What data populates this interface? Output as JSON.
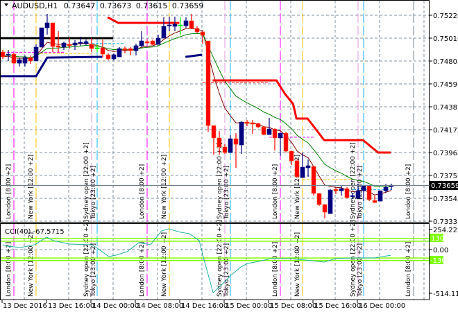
{
  "header": {
    "dropdown_icon": "triangle-down-icon",
    "symbol": "AUDUSD,H1",
    "open": "0.73647",
    "high": "0.73673",
    "low": "0.73615",
    "close": "0.73659"
  },
  "price_axis": {
    "labels": [
      "0.75220",
      "0.75010",
      "0.74805",
      "0.74595",
      "0.74385",
      "0.74175",
      "0.73965",
      "0.73755",
      "0.73545",
      "0.73335"
    ],
    "current_price": "0.73659"
  },
  "indicator": {
    "label": "CCI(40) -67.5715",
    "axis_max": "254.2226",
    "axis_zero": "0.00",
    "axis_min": "-514.1127",
    "level_high": "130",
    "level_low": "-130",
    "level_color": "#80ff00"
  },
  "time_axis": {
    "labels": [
      "13 Dec 2016",
      "13 Dec 16:00",
      "14 Dec 00:00",
      "14 Dec 08:00",
      "14 Dec 16:00",
      "15 Dec 00:00",
      "15 Dec 08:00",
      "15 Dec 16:00",
      "16 Dec 00:00"
    ]
  },
  "sessions": {
    "london": "London [8:00 +2]",
    "new_york": "New York [12:00 +2]",
    "sydney": "Sydney open [22:00 +2]",
    "tokyo": "Tokyo [23:00 +2]",
    "colors": {
      "london": "#ff00ff",
      "new_york": "#ffc000",
      "sydney": "#dd99dd",
      "tokyo": "#10b0f0"
    }
  },
  "colors": {
    "bull": "#000080",
    "bear": "#ff0000",
    "doji": "#00ff00",
    "ma_fast": "#800000",
    "ma_slow": "#008000",
    "stop_line": "#ff0000",
    "support_line": "#000080"
  },
  "chart_data": {
    "type": "candlestick",
    "title": "AUDUSD,H1",
    "ylim": [
      0.73335,
      0.7522
    ],
    "ohlc": [
      [
        0.74882,
        0.74901,
        0.74819,
        0.74838
      ],
      [
        0.74857,
        0.74901,
        0.748,
        0.74863
      ],
      [
        0.74863,
        0.74876,
        0.74774,
        0.7478
      ],
      [
        0.7478,
        0.74831,
        0.74749,
        0.74812
      ],
      [
        0.7478,
        0.74851,
        0.74749,
        0.74831
      ],
      [
        0.74831,
        0.74851,
        0.74774,
        0.748
      ],
      [
        0.748,
        0.74952,
        0.748,
        0.74927
      ],
      [
        0.74927,
        0.75105,
        0.74927,
        0.75105
      ],
      [
        0.75105,
        0.75233,
        0.75042,
        0.7515
      ],
      [
        0.7515,
        0.7515,
        0.74882,
        0.74933
      ],
      [
        0.7494,
        0.75073,
        0.74882,
        0.74927
      ],
      [
        0.74927,
        0.74978,
        0.74901,
        0.74965
      ],
      [
        0.74952,
        0.7501,
        0.74914,
        0.7494
      ],
      [
        0.74946,
        0.74991,
        0.74901,
        0.74965
      ],
      [
        0.74965,
        0.75023,
        0.7494,
        0.74972
      ],
      [
        0.74959,
        0.74997,
        0.74946,
        0.74978
      ],
      [
        0.74952,
        0.7501,
        0.74882,
        0.74914
      ],
      [
        0.74921,
        0.74952,
        0.74882,
        0.74921
      ],
      [
        0.74921,
        0.74997,
        0.74831,
        0.74863
      ],
      [
        0.74857,
        0.7487,
        0.74806,
        0.74819
      ],
      [
        0.74819,
        0.7487,
        0.74806,
        0.74857
      ],
      [
        0.74838,
        0.74927,
        0.74838,
        0.74914
      ],
      [
        0.74914,
        0.74933,
        0.7487,
        0.74901
      ],
      [
        0.74914,
        0.74927,
        0.74851,
        0.74895
      ],
      [
        0.74895,
        0.74959,
        0.74851,
        0.7494
      ],
      [
        0.7494,
        0.75073,
        0.74927,
        0.74984
      ],
      [
        0.74978,
        0.74997,
        0.74959,
        0.74965
      ],
      [
        0.74984,
        0.74997,
        0.74946,
        0.74952
      ],
      [
        0.74952,
        0.75042,
        0.74952,
        0.7501
      ],
      [
        0.7501,
        0.75201,
        0.7501,
        0.75118
      ],
      [
        0.75124,
        0.75207,
        0.75073,
        0.75131
      ],
      [
        0.75118,
        0.75207,
        0.75073,
        0.75137
      ],
      [
        0.75131,
        0.75201,
        0.75042,
        0.75131
      ],
      [
        0.75124,
        0.75201,
        0.75105,
        0.75169
      ],
      [
        0.75169,
        0.75233,
        0.75093,
        0.75099
      ],
      [
        0.75099,
        0.75118,
        0.75054,
        0.75067
      ],
      [
        0.75067,
        0.7508,
        0.74959,
        0.75035
      ],
      [
        0.74984,
        0.74984,
        0.7415,
        0.74207
      ],
      [
        0.74207,
        0.74207,
        0.7394,
        0.74093
      ],
      [
        0.74093,
        0.74156,
        0.7394,
        0.7401
      ],
      [
        0.7401,
        0.74035,
        0.73946,
        0.73959
      ],
      [
        0.73959,
        0.74118,
        0.73959,
        0.74086
      ],
      [
        0.74086,
        0.74137,
        0.73819,
        0.74035
      ],
      [
        0.74029,
        0.74245,
        0.73946,
        0.74239
      ],
      [
        0.74239,
        0.74258,
        0.74201,
        0.74226
      ],
      [
        0.74233,
        0.74258,
        0.74131,
        0.7422
      ],
      [
        0.74226,
        0.74233,
        0.74182,
        0.74194
      ],
      [
        0.74194,
        0.74201,
        0.74118,
        0.74124
      ],
      [
        0.74124,
        0.74277,
        0.74124,
        0.74175
      ],
      [
        0.74175,
        0.74182,
        0.73978,
        0.74093
      ],
      [
        0.74093,
        0.74137,
        0.73927,
        0.74137
      ],
      [
        0.74137,
        0.7415,
        0.73959,
        0.73972
      ],
      [
        0.73972,
        0.73978,
        0.73844,
        0.73882
      ],
      [
        0.73882,
        0.73895,
        0.73729,
        0.73736
      ],
      [
        0.73729,
        0.73959,
        0.73729,
        0.73825
      ],
      [
        0.73819,
        0.73895,
        0.73736,
        0.73838
      ],
      [
        0.73831,
        0.73838,
        0.73564,
        0.73583
      ],
      [
        0.73583,
        0.73589,
        0.73468,
        0.73481
      ],
      [
        0.73481,
        0.73487,
        0.73354,
        0.73411
      ],
      [
        0.73398,
        0.73621,
        0.73398,
        0.73615
      ],
      [
        0.73621,
        0.73634,
        0.73577,
        0.73608
      ],
      [
        0.73608,
        0.73659,
        0.73564,
        0.73627
      ],
      [
        0.73627,
        0.7364,
        0.73538,
        0.73545
      ],
      [
        0.73557,
        0.73589,
        0.73532,
        0.73564
      ],
      [
        0.73538,
        0.73672,
        0.73532,
        0.73608
      ],
      [
        0.73608,
        0.73659,
        0.73513,
        0.73653
      ],
      [
        0.73653,
        0.73653,
        0.73513,
        0.73526
      ],
      [
        0.73519,
        0.73564,
        0.73494,
        0.735
      ],
      [
        0.73513,
        0.73608,
        0.73513,
        0.73608
      ],
      [
        0.73608,
        0.73672,
        0.73589,
        0.7364
      ],
      [
        0.73647,
        0.73673,
        0.73615,
        0.73659
      ]
    ],
    "stop_line": [
      [
        18.9,
        0.75201
      ],
      [
        20.8,
        0.7515
      ],
      [
        31.8,
        0.7515
      ],
      null,
      [
        37.8,
        0.74621
      ],
      [
        49.3,
        0.74621
      ],
      [
        50.8,
        0.745
      ],
      [
        52.3,
        0.74405
      ],
      [
        52.9,
        0.74271
      ],
      [
        54.9,
        0.74271
      ],
      [
        57.9,
        0.74073
      ],
      [
        64.9,
        0.74073
      ],
      [
        67.6,
        0.73959
      ],
      [
        69.9,
        0.73959
      ]
    ],
    "support_line": [
      [
        -0.5,
        0.7466
      ],
      [
        6,
        0.7466
      ],
      [
        8,
        0.74831
      ],
      [
        17.9,
        0.74838
      ],
      null,
      [
        32.9,
        0.74838
      ],
      [
        35.9,
        0.74857
      ]
    ],
    "resistance_line": [
      [
        -0.5,
        0.7501
      ],
      [
        19.9,
        0.7501
      ]
    ],
    "cci": {
      "period": 40,
      "range": [
        -514.1127,
        254.2226
      ],
      "levels": [
        130,
        100,
        -100,
        -130
      ],
      "points": [
        [
          0,
          58
        ],
        [
          0.75,
          41
        ],
        [
          3.25,
          25
        ],
        [
          5.75,
          58
        ],
        [
          7.9,
          149
        ],
        [
          9.1,
          107
        ],
        [
          12,
          66
        ],
        [
          16.1,
          58
        ],
        [
          17.9,
          -25
        ],
        [
          19.1,
          -83
        ],
        [
          20.4,
          -66
        ],
        [
          22.4,
          -25
        ],
        [
          24.5,
          83
        ],
        [
          26.6,
          58
        ],
        [
          28.6,
          223
        ],
        [
          29.9,
          248
        ],
        [
          32,
          207
        ],
        [
          33.6,
          190
        ],
        [
          35.4,
          107
        ],
        [
          36.1,
          -83
        ],
        [
          37.9,
          -514
        ],
        [
          39.9,
          -388
        ],
        [
          41.1,
          -306
        ],
        [
          42.9,
          -207
        ],
        [
          44.1,
          -165
        ],
        [
          46.1,
          -140
        ],
        [
          48.3,
          -107
        ],
        [
          51.6,
          -107
        ],
        [
          54.5,
          -124
        ],
        [
          57.9,
          -149
        ],
        [
          59.9,
          -107
        ],
        [
          62.9,
          -99
        ],
        [
          67,
          -99
        ],
        [
          69.9,
          -67.57
        ]
      ]
    }
  }
}
